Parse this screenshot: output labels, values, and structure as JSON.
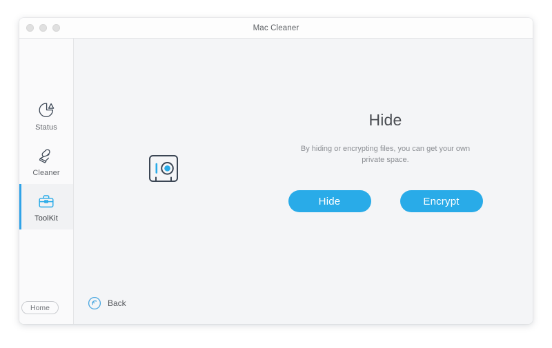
{
  "window": {
    "title": "Mac Cleaner",
    "traffic_lights": [
      "close-dot",
      "minimize-dot",
      "maximize-dot"
    ]
  },
  "sidebar": {
    "items": [
      {
        "label": "Status",
        "icon": "pie-chart-icon",
        "selected": false
      },
      {
        "label": "Cleaner",
        "icon": "brush-icon",
        "selected": false
      },
      {
        "label": "ToolKit",
        "icon": "toolbox-icon",
        "selected": true
      }
    ],
    "home_label": "Home"
  },
  "main": {
    "feature_icon": "safe-vault-icon",
    "title": "Hide",
    "description": "By hiding or encrypting files, you can get your own private space.",
    "buttons": [
      {
        "label": "Hide"
      },
      {
        "label": "Encrypt"
      }
    ]
  },
  "footer": {
    "back_label": "Back",
    "back_icon": "back-arrow-circle-icon"
  },
  "colors": {
    "accent": "#29abe8",
    "accent_selected_bar": "#2fa3e8",
    "icon_outline": "#3b4654",
    "window_bg": "#f4f5f7",
    "sidebar_bg": "#fafafb",
    "title_bar_bg": "#fdfdfd"
  }
}
